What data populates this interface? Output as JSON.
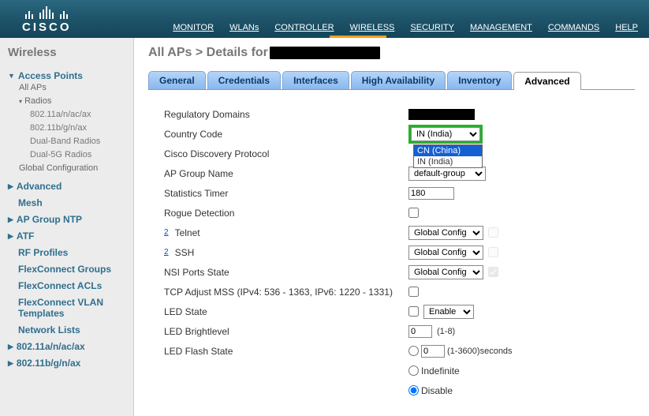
{
  "topnav": {
    "logo": "CISCO",
    "items": [
      "MONITOR",
      "WLANs",
      "CONTROLLER",
      "WIRELESS",
      "SECURITY",
      "MANAGEMENT",
      "COMMANDS",
      "HELP"
    ],
    "active_index": 3
  },
  "sidebar": {
    "title": "Wireless",
    "ap_head": "Access Points",
    "all_aps": "All APs",
    "radios": "Radios",
    "radio_items": [
      "802.11a/n/ac/ax",
      "802.11b/g/n/ax",
      "Dual-Band Radios",
      "Dual-5G Radios"
    ],
    "global_conf": "Global Configuration",
    "items": [
      "Advanced",
      "Mesh",
      "AP Group NTP",
      "ATF",
      "RF Profiles",
      "FlexConnect Groups",
      "FlexConnect ACLs",
      "FlexConnect VLAN Templates",
      "Network Lists",
      "802.11a/n/ac/ax",
      "802.11b/g/n/ax"
    ]
  },
  "page": {
    "title_prefix": "All APs > Details for "
  },
  "tabs": [
    "General",
    "Credentials",
    "Interfaces",
    "High Availability",
    "Inventory",
    "Advanced"
  ],
  "active_tab": 5,
  "form": {
    "reg_domains": "Regulatory Domains",
    "country_code": "Country Code",
    "country_sel": "IN (India)",
    "country_opts": {
      "cn": "CN (China)",
      "in": "IN (India)"
    },
    "cdp": "Cisco Discovery Protocol",
    "ap_group": "AP Group Name",
    "ap_group_sel": "default-group",
    "stats_timer": "Statistics Timer",
    "stats_val": "180",
    "rogue": "Rogue Detection",
    "telnet": "Telnet",
    "ssh": "SSH",
    "global_cfg": "Global Config",
    "nsi": "NSI Ports State",
    "tcp_mss": "TCP Adjust MSS (IPv4: 536 - 1363, IPv6: 1220 - 1331)",
    "led_state": "LED State",
    "enable": "Enable",
    "led_bright": "LED Brightlevel",
    "bright_val": "0",
    "bright_range": "(1-8)",
    "led_flash": "LED Flash State",
    "flash_val": "0",
    "flash_range": "(1-3600)seconds",
    "indef": "Indefinite",
    "disable": "Disable",
    "footnote": "2"
  }
}
